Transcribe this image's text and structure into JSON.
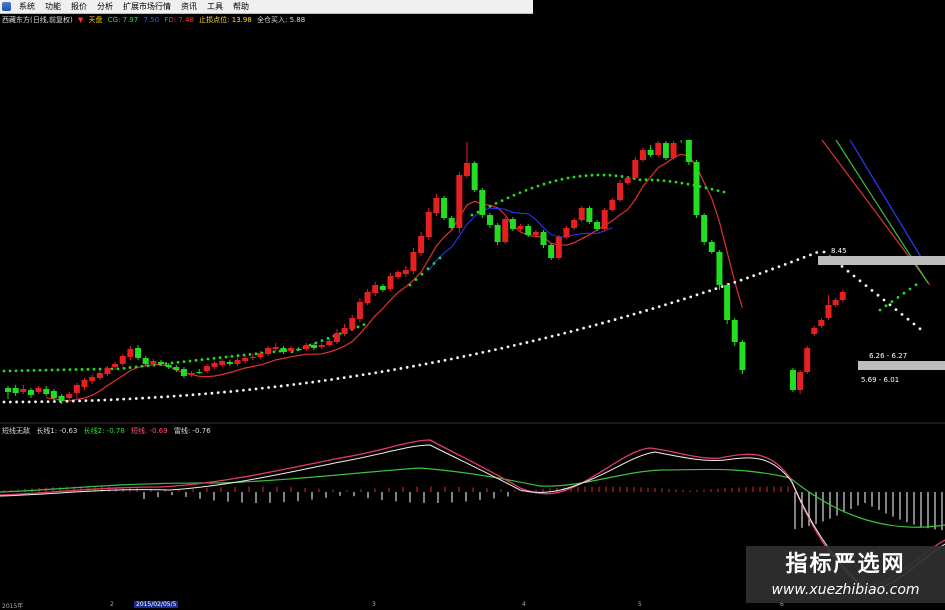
{
  "menu": [
    "系统",
    "功能",
    "报价",
    "分析",
    "扩展市场行情",
    "资讯",
    "工具",
    "帮助"
  ],
  "info": {
    "title": "西藏东方(日线,前复权)",
    "indicator": "天盘",
    "cg": "CG: 7.97",
    "value2": "7.50",
    "fd": "FD: 7.48",
    "stop": "止损点位: 13.98",
    "buy": "全仓买入: 5.88"
  },
  "price_labels": [
    {
      "text": "8.45"
    },
    {
      "text": "6.26 - 6.27"
    },
    {
      "text": "5.69 - 6.01"
    }
  ],
  "indicator_panel": {
    "name": "短线无敌",
    "l1": "长线1: -0.63",
    "l2": "长线2: -0.78",
    "l3": "短线: -0.69",
    "l4": "雷线: -0.76"
  },
  "date_axis": [
    "2015年",
    "2",
    "2015/02/05/5",
    "3",
    "4",
    "5",
    "6"
  ],
  "watermark": {
    "title": "指标严选网",
    "url": "www.xuezhibiao.com"
  },
  "colors": {
    "up": "#e52020",
    "down": "#22dd22",
    "ma_red": "#e03030",
    "ma_green": "#3ac23a",
    "ma_blue": "#2a3cff"
  },
  "chart_data": {
    "type": "candlestick",
    "candles": [
      [
        388,
        392,
        399,
        386
      ],
      [
        388,
        393,
        396,
        385
      ],
      [
        392,
        389,
        394,
        385
      ],
      [
        390,
        395,
        398,
        388
      ],
      [
        392,
        388,
        394,
        386
      ],
      [
        389,
        394,
        396,
        386
      ],
      [
        391,
        398,
        400,
        389
      ],
      [
        396,
        401,
        404,
        394
      ],
      [
        398,
        394,
        400,
        392
      ],
      [
        393,
        385,
        398,
        383
      ],
      [
        387,
        380,
        390,
        378
      ],
      [
        381,
        377,
        384,
        375
      ],
      [
        378,
        373,
        380,
        371
      ],
      [
        374,
        368,
        376,
        366
      ],
      [
        367,
        364,
        370,
        362
      ],
      [
        364,
        356,
        366,
        354
      ],
      [
        357,
        349,
        360,
        346
      ],
      [
        348,
        358,
        360,
        345
      ],
      [
        358,
        364,
        366,
        356
      ],
      [
        364,
        361,
        367,
        359
      ],
      [
        362,
        364,
        366,
        360
      ],
      [
        365,
        367,
        369,
        363
      ],
      [
        367,
        370,
        372,
        365
      ],
      [
        369,
        376,
        378,
        367
      ],
      [
        375,
        373,
        377,
        371
      ],
      [
        372,
        372,
        374,
        369
      ],
      [
        371,
        366,
        373,
        364
      ],
      [
        367,
        363,
        369,
        361
      ],
      [
        365,
        361,
        367,
        359
      ],
      [
        362,
        364,
        366,
        360
      ],
      [
        364,
        360,
        366,
        358
      ],
      [
        361,
        358,
        363,
        356
      ],
      [
        358,
        357,
        360,
        354
      ],
      [
        357,
        353,
        359,
        351
      ],
      [
        354,
        348,
        356,
        346
      ],
      [
        349,
        347,
        351,
        343
      ],
      [
        348,
        352,
        354,
        346
      ],
      [
        351,
        348,
        353,
        346
      ],
      [
        349,
        349,
        351,
        347
      ],
      [
        349,
        345,
        351,
        343
      ],
      [
        345,
        348,
        350,
        343
      ],
      [
        347,
        345,
        349,
        343
      ],
      [
        345,
        341,
        347,
        339
      ],
      [
        342,
        333,
        344,
        329
      ],
      [
        334,
        328,
        336,
        324
      ],
      [
        329,
        318,
        331,
        315
      ],
      [
        319,
        302,
        322,
        298
      ],
      [
        303,
        292,
        305,
        289
      ],
      [
        293,
        285,
        296,
        282
      ],
      [
        286,
        290,
        292,
        284
      ],
      [
        289,
        276,
        291,
        273
      ],
      [
        277,
        272,
        279,
        270
      ],
      [
        274,
        270,
        277,
        266
      ],
      [
        271,
        252,
        274,
        248
      ],
      [
        253,
        236,
        256,
        232
      ],
      [
        237,
        212,
        240,
        208
      ],
      [
        213,
        198,
        216,
        194
      ],
      [
        198,
        218,
        220,
        196
      ],
      [
        218,
        228,
        230,
        216
      ],
      [
        228,
        175,
        233,
        172
      ],
      [
        176,
        163,
        178,
        142
      ],
      [
        163,
        190,
        192,
        161
      ],
      [
        190,
        215,
        218,
        188
      ],
      [
        215,
        225,
        228,
        213
      ],
      [
        225,
        242,
        245,
        223
      ],
      [
        242,
        219,
        244,
        217
      ],
      [
        219,
        229,
        231,
        217
      ],
      [
        229,
        226,
        231,
        224
      ],
      [
        226,
        235,
        237,
        224
      ],
      [
        235,
        232,
        237,
        230
      ],
      [
        232,
        245,
        248,
        230
      ],
      [
        245,
        258,
        260,
        243
      ],
      [
        258,
        237,
        260,
        235
      ],
      [
        237,
        228,
        239,
        226
      ],
      [
        228,
        220,
        230,
        218
      ],
      [
        220,
        208,
        222,
        206
      ],
      [
        208,
        222,
        224,
        206
      ],
      [
        222,
        229,
        231,
        220
      ],
      [
        229,
        210,
        231,
        208
      ],
      [
        210,
        200,
        212,
        198
      ],
      [
        200,
        183,
        202,
        180
      ],
      [
        183,
        178,
        185,
        176
      ],
      [
        178,
        160,
        180,
        157
      ],
      [
        160,
        150,
        162,
        148
      ],
      [
        150,
        155,
        157,
        145
      ],
      [
        155,
        143,
        157,
        141
      ],
      [
        143,
        158,
        160,
        141
      ],
      [
        158,
        143,
        160,
        141
      ],
      [
        137,
        140,
        143,
        130
      ],
      [
        140,
        162,
        165,
        138
      ],
      [
        162,
        215,
        218,
        160
      ],
      [
        215,
        242,
        245,
        213
      ],
      [
        242,
        252,
        254,
        240
      ],
      [
        252,
        285,
        290,
        250
      ],
      [
        285,
        320,
        324,
        283
      ],
      [
        320,
        342,
        346,
        318
      ],
      [
        342,
        370,
        374,
        340
      ],
      [
        370,
        390,
        392,
        368
      ],
      [
        390,
        372,
        394,
        370
      ],
      [
        372,
        348,
        374,
        346
      ],
      [
        334,
        328,
        336,
        326
      ],
      [
        326,
        320,
        328,
        318
      ],
      [
        318,
        305,
        320,
        295
      ],
      [
        305,
        300,
        307,
        298
      ],
      [
        300,
        292,
        302,
        290
      ]
    ]
  }
}
